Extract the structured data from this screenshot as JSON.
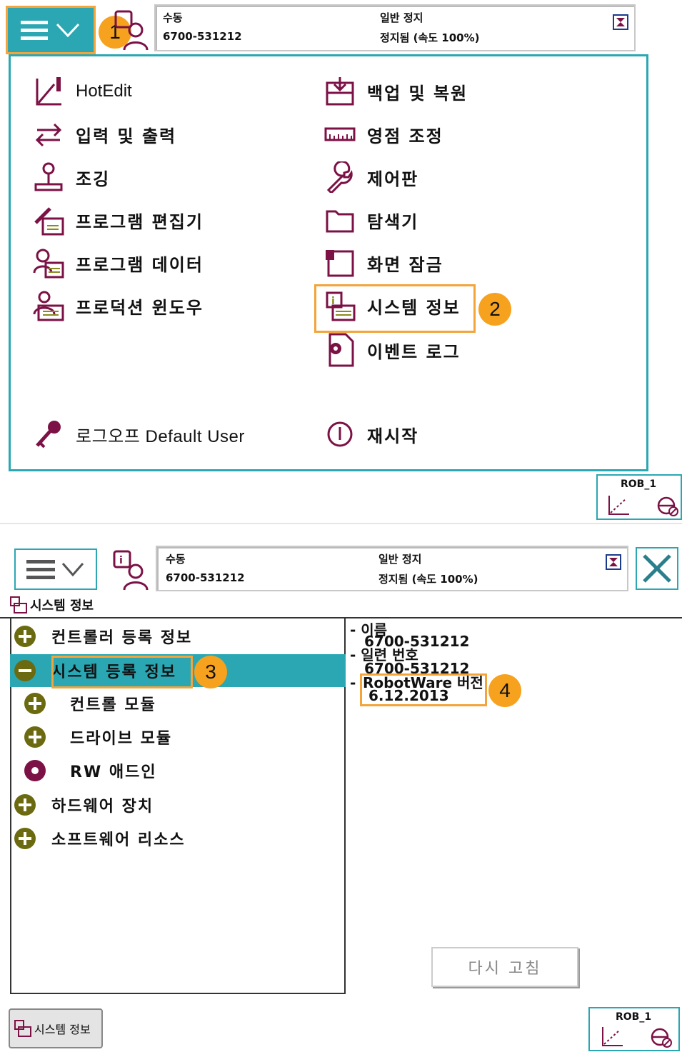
{
  "top": {
    "status": {
      "mode": "수동",
      "system_id": "6700-531212",
      "stop_label": "일반 정지",
      "speed_status": "정지됨 (속도 100%)"
    },
    "menu_left": [
      {
        "label": "HotEdit",
        "icon": "hotedit-icon"
      },
      {
        "label": "입력 및 출력",
        "icon": "io-icon"
      },
      {
        "label": "조깅",
        "icon": "jogging-icon"
      },
      {
        "label": "프로그램 편집기",
        "icon": "program-editor-icon"
      },
      {
        "label": "프로그램 데이터",
        "icon": "program-data-icon"
      },
      {
        "label": "프로덕션 윈도우",
        "icon": "production-window-icon"
      }
    ],
    "menu_right": [
      {
        "label": "백업 및 복원",
        "icon": "backup-icon"
      },
      {
        "label": "영점 조정",
        "icon": "calibration-icon"
      },
      {
        "label": "제어판",
        "icon": "wrench-icon"
      },
      {
        "label": "탐색기",
        "icon": "folder-icon"
      },
      {
        "label": "화면 잠금",
        "icon": "lock-icon"
      },
      {
        "label": "시스템 정보",
        "icon": "system-info-icon"
      },
      {
        "label": "이벤트 로그",
        "icon": "event-log-icon"
      }
    ],
    "logoff_label": "로그오프 Default User",
    "restart_label": "재시작",
    "rob_label": "ROB_1",
    "callouts": [
      "1",
      "2"
    ]
  },
  "bottom": {
    "status": {
      "mode": "수동",
      "system_id": "6700-531212",
      "stop_label": "일반 정지",
      "speed_status": "정지됨 (속도 100%)"
    },
    "window_title": "시스템 정보",
    "tree": [
      {
        "label": "컨트롤러 등록 정보",
        "node": "plus",
        "indent": 0
      },
      {
        "label": "시스템 등록 정보",
        "node": "minus",
        "indent": 0,
        "selected": true
      },
      {
        "label": "컨트롤 모듈",
        "node": "plus",
        "indent": 1
      },
      {
        "label": "드라이브 모듈",
        "node": "plus",
        "indent": 1
      },
      {
        "label": "RW 애드인",
        "node": "dot",
        "indent": 1
      },
      {
        "label": "하드웨어 장치",
        "node": "plus",
        "indent": 0
      },
      {
        "label": "소프트웨어 리소스",
        "node": "plus",
        "indent": 0
      }
    ],
    "info": {
      "name_label": "- 이름",
      "name_value": "6700-531212",
      "serial_label": "- 일련 번호",
      "serial_value": "6700-531212",
      "rw_label": "RobotWare 버전",
      "rw_dash": "-",
      "rw_value": "6.12.2013"
    },
    "refresh_button": "다시 고침",
    "taskbar_label": "시스템 정보",
    "rob_label": "ROB_1",
    "callouts": [
      "3",
      "4"
    ]
  },
  "colors": {
    "accent": "#2aa7b3",
    "callout": "#f6a21e",
    "frame": "#f3a43b",
    "node": "#6b6a10",
    "icon": "#7b1145"
  }
}
